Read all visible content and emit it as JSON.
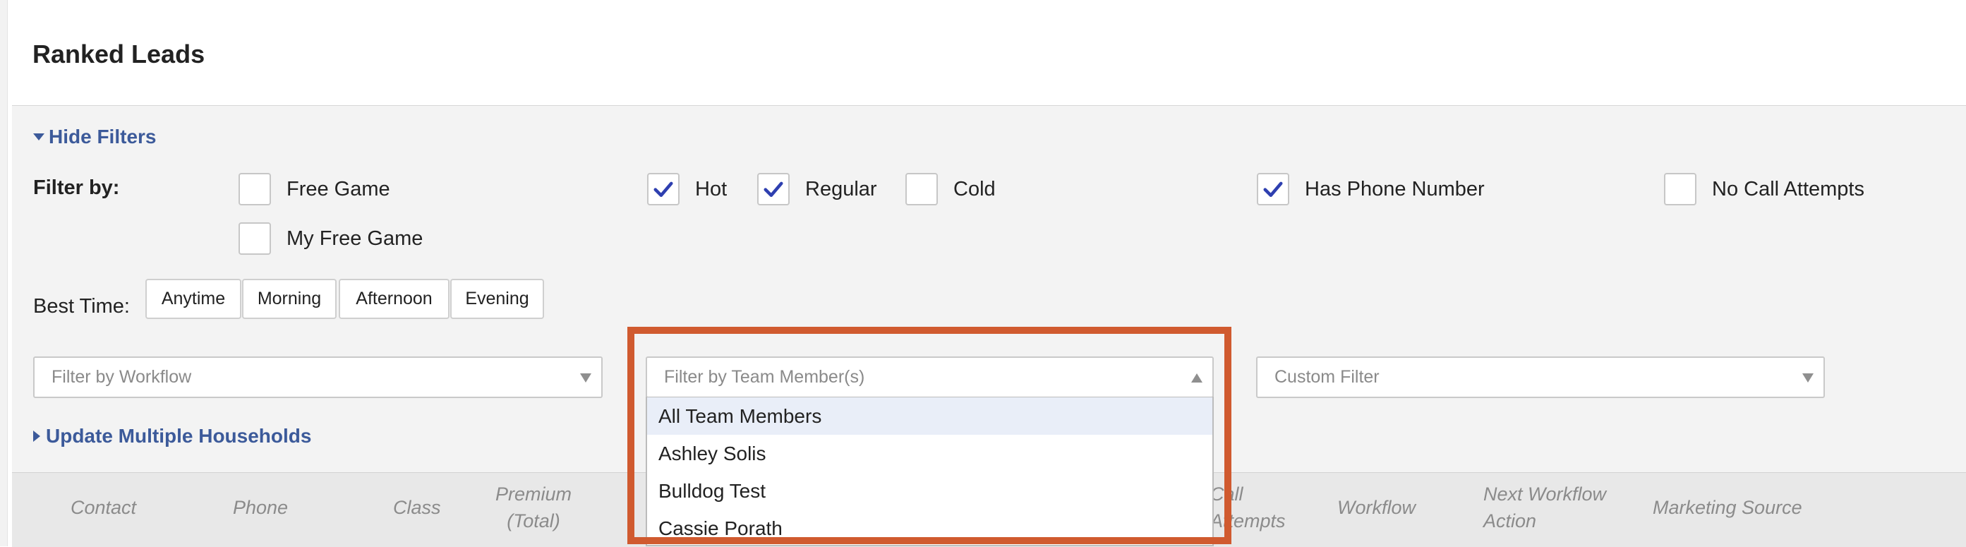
{
  "page": {
    "title": "Ranked Leads"
  },
  "filters": {
    "hide_filters_label": "Hide Filters",
    "filter_by_label": "Filter by:",
    "checkboxes": {
      "free_game": {
        "label": "Free Game",
        "checked": false
      },
      "my_free_game": {
        "label": "My Free Game",
        "checked": false
      },
      "hot": {
        "label": "Hot",
        "checked": true
      },
      "regular": {
        "label": "Regular",
        "checked": true
      },
      "cold": {
        "label": "Cold",
        "checked": false
      },
      "has_phone": {
        "label": "Has Phone Number",
        "checked": true
      },
      "no_call_attempts": {
        "label": "No Call Attempts",
        "checked": false
      }
    },
    "best_time_label": "Best Time:",
    "best_time_buttons": [
      "Anytime",
      "Morning",
      "Afternoon",
      "Evening"
    ],
    "workflow_placeholder": "Filter by Workflow",
    "team_member_placeholder": "Filter by Team Member(s)",
    "custom_filter_placeholder": "Custom Filter",
    "team_member_options": [
      "All Team Members",
      "Ashley Solis",
      "Bulldog Test",
      "Cassie Porath"
    ],
    "update_households_label": "Update Multiple Households"
  },
  "table": {
    "headers": {
      "contact": "Contact",
      "phone": "Phone",
      "class": "Class",
      "premium": "Premium (Total)",
      "call_attempts": "Call Attempts",
      "workflow": "Workflow",
      "next_action": "Next Workflow Action",
      "marketing_source": "Marketing Source"
    }
  },
  "colors": {
    "accent": "#3c5a9a",
    "check": "#2e3fb0",
    "highlight_box": "#d05a2f",
    "panel_bg": "#f3f3f3"
  },
  "icons": {
    "checkbox_checked": "checkmark-icon",
    "select_arrow": "caret-down-icon",
    "select_arrow_open": "caret-up-icon",
    "toggle_expanded": "triangle-down-icon",
    "toggle_collapsed": "triangle-right-icon"
  }
}
